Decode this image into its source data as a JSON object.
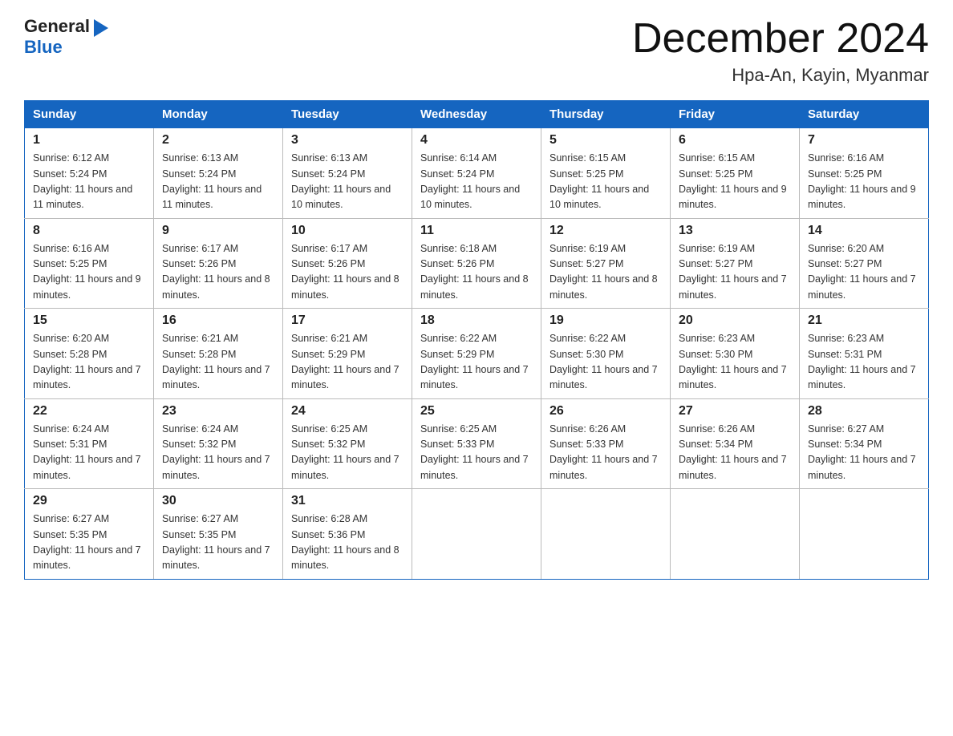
{
  "header": {
    "logo_general": "General",
    "logo_blue": "Blue",
    "month_year": "December 2024",
    "location": "Hpa-An, Kayin, Myanmar"
  },
  "columns": [
    "Sunday",
    "Monday",
    "Tuesday",
    "Wednesday",
    "Thursday",
    "Friday",
    "Saturday"
  ],
  "weeks": [
    [
      {
        "day": "1",
        "sunrise": "6:12 AM",
        "sunset": "5:24 PM",
        "daylight": "11 hours and 11 minutes."
      },
      {
        "day": "2",
        "sunrise": "6:13 AM",
        "sunset": "5:24 PM",
        "daylight": "11 hours and 11 minutes."
      },
      {
        "day": "3",
        "sunrise": "6:13 AM",
        "sunset": "5:24 PM",
        "daylight": "11 hours and 10 minutes."
      },
      {
        "day": "4",
        "sunrise": "6:14 AM",
        "sunset": "5:24 PM",
        "daylight": "11 hours and 10 minutes."
      },
      {
        "day": "5",
        "sunrise": "6:15 AM",
        "sunset": "5:25 PM",
        "daylight": "11 hours and 10 minutes."
      },
      {
        "day": "6",
        "sunrise": "6:15 AM",
        "sunset": "5:25 PM",
        "daylight": "11 hours and 9 minutes."
      },
      {
        "day": "7",
        "sunrise": "6:16 AM",
        "sunset": "5:25 PM",
        "daylight": "11 hours and 9 minutes."
      }
    ],
    [
      {
        "day": "8",
        "sunrise": "6:16 AM",
        "sunset": "5:25 PM",
        "daylight": "11 hours and 9 minutes."
      },
      {
        "day": "9",
        "sunrise": "6:17 AM",
        "sunset": "5:26 PM",
        "daylight": "11 hours and 8 minutes."
      },
      {
        "day": "10",
        "sunrise": "6:17 AM",
        "sunset": "5:26 PM",
        "daylight": "11 hours and 8 minutes."
      },
      {
        "day": "11",
        "sunrise": "6:18 AM",
        "sunset": "5:26 PM",
        "daylight": "11 hours and 8 minutes."
      },
      {
        "day": "12",
        "sunrise": "6:19 AM",
        "sunset": "5:27 PM",
        "daylight": "11 hours and 8 minutes."
      },
      {
        "day": "13",
        "sunrise": "6:19 AM",
        "sunset": "5:27 PM",
        "daylight": "11 hours and 7 minutes."
      },
      {
        "day": "14",
        "sunrise": "6:20 AM",
        "sunset": "5:27 PM",
        "daylight": "11 hours and 7 minutes."
      }
    ],
    [
      {
        "day": "15",
        "sunrise": "6:20 AM",
        "sunset": "5:28 PM",
        "daylight": "11 hours and 7 minutes."
      },
      {
        "day": "16",
        "sunrise": "6:21 AM",
        "sunset": "5:28 PM",
        "daylight": "11 hours and 7 minutes."
      },
      {
        "day": "17",
        "sunrise": "6:21 AM",
        "sunset": "5:29 PM",
        "daylight": "11 hours and 7 minutes."
      },
      {
        "day": "18",
        "sunrise": "6:22 AM",
        "sunset": "5:29 PM",
        "daylight": "11 hours and 7 minutes."
      },
      {
        "day": "19",
        "sunrise": "6:22 AM",
        "sunset": "5:30 PM",
        "daylight": "11 hours and 7 minutes."
      },
      {
        "day": "20",
        "sunrise": "6:23 AM",
        "sunset": "5:30 PM",
        "daylight": "11 hours and 7 minutes."
      },
      {
        "day": "21",
        "sunrise": "6:23 AM",
        "sunset": "5:31 PM",
        "daylight": "11 hours and 7 minutes."
      }
    ],
    [
      {
        "day": "22",
        "sunrise": "6:24 AM",
        "sunset": "5:31 PM",
        "daylight": "11 hours and 7 minutes."
      },
      {
        "day": "23",
        "sunrise": "6:24 AM",
        "sunset": "5:32 PM",
        "daylight": "11 hours and 7 minutes."
      },
      {
        "day": "24",
        "sunrise": "6:25 AM",
        "sunset": "5:32 PM",
        "daylight": "11 hours and 7 minutes."
      },
      {
        "day": "25",
        "sunrise": "6:25 AM",
        "sunset": "5:33 PM",
        "daylight": "11 hours and 7 minutes."
      },
      {
        "day": "26",
        "sunrise": "6:26 AM",
        "sunset": "5:33 PM",
        "daylight": "11 hours and 7 minutes."
      },
      {
        "day": "27",
        "sunrise": "6:26 AM",
        "sunset": "5:34 PM",
        "daylight": "11 hours and 7 minutes."
      },
      {
        "day": "28",
        "sunrise": "6:27 AM",
        "sunset": "5:34 PM",
        "daylight": "11 hours and 7 minutes."
      }
    ],
    [
      {
        "day": "29",
        "sunrise": "6:27 AM",
        "sunset": "5:35 PM",
        "daylight": "11 hours and 7 minutes."
      },
      {
        "day": "30",
        "sunrise": "6:27 AM",
        "sunset": "5:35 PM",
        "daylight": "11 hours and 7 minutes."
      },
      {
        "day": "31",
        "sunrise": "6:28 AM",
        "sunset": "5:36 PM",
        "daylight": "11 hours and 8 minutes."
      },
      null,
      null,
      null,
      null
    ]
  ]
}
